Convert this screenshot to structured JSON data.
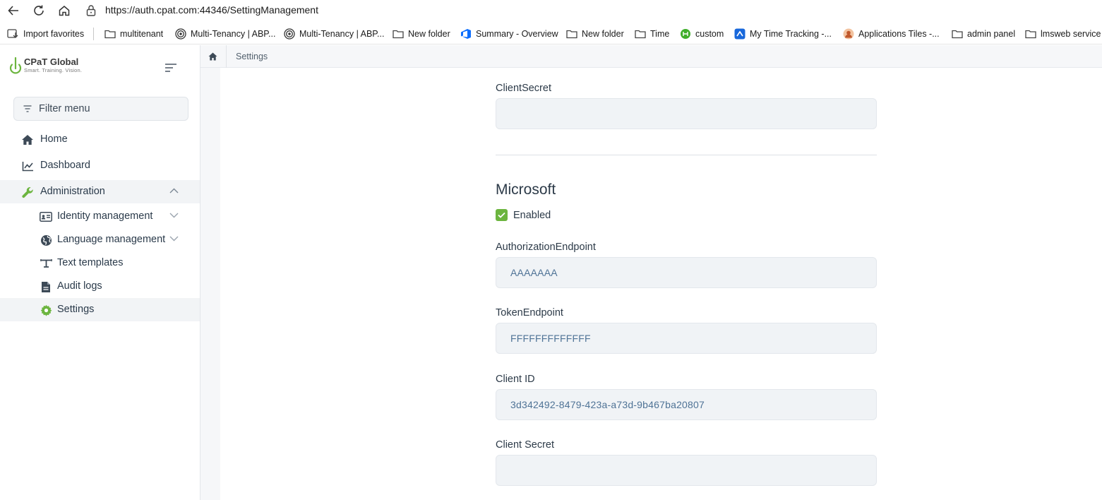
{
  "browser": {
    "url_host": "https://auth.cpat.com",
    "url_rest": ":44346/SettingManagement",
    "bookmarks": [
      {
        "label": "Import favorites",
        "icon": "import-icon"
      },
      {
        "label": "multitenant",
        "icon": "folder-icon"
      },
      {
        "label": "Multi-Tenancy | ABP...",
        "icon": "abp-icon"
      },
      {
        "label": "Multi-Tenancy | ABP...",
        "icon": "abp-icon"
      },
      {
        "label": "New folder",
        "icon": "folder-icon"
      },
      {
        "label": "Summary - Overview",
        "icon": "azure-devops-icon"
      },
      {
        "label": "New folder",
        "icon": "folder-icon"
      },
      {
        "label": "Time",
        "icon": "folder-icon"
      },
      {
        "label": "custom",
        "icon": "custom-icon"
      },
      {
        "label": "My Time Tracking -...",
        "icon": "jira-icon"
      },
      {
        "label": "Applications Tiles -...",
        "icon": "avatar-icon"
      },
      {
        "label": "admin panel",
        "icon": "folder-icon"
      },
      {
        "label": "lmsweb service",
        "icon": "folder-icon"
      }
    ]
  },
  "sidebar": {
    "logo_title": "CPaT Global",
    "logo_subtitle": "Smart. Training. Vision.",
    "filter_placeholder": "Filter menu",
    "items": [
      {
        "label": "Home",
        "icon": "home-icon"
      },
      {
        "label": "Dashboard",
        "icon": "chart-line-icon"
      },
      {
        "label": "Administration",
        "icon": "wrench-icon"
      },
      {
        "label": "Identity management",
        "icon": "id-card-icon"
      },
      {
        "label": "Language management",
        "icon": "globe-icon"
      },
      {
        "label": "Text templates",
        "icon": "text-template-icon"
      },
      {
        "label": "Audit logs",
        "icon": "file-icon"
      },
      {
        "label": "Settings",
        "icon": "gear-icon"
      }
    ]
  },
  "breadcrumb": {
    "current": "Settings"
  },
  "form": {
    "client_secret_label_top": "ClientSecret",
    "client_secret_value_top": "",
    "section_title": "Microsoft",
    "enabled_label": "Enabled",
    "authorization_endpoint_label": "AuthorizationEndpoint",
    "authorization_endpoint_value": "AAAAAAA",
    "token_endpoint_label": "TokenEndpoint",
    "token_endpoint_value": "FFFFFFFFFFFFF",
    "client_id_label": "Client ID",
    "client_id_value": "3d342492-8479-423a-a73d-9b467ba20807",
    "client_secret_label": "Client Secret",
    "client_secret_value": ""
  },
  "colors": {
    "accent_green": "#6cb53f",
    "field_bg": "#f0f3f6",
    "value_text": "#4f7396"
  }
}
